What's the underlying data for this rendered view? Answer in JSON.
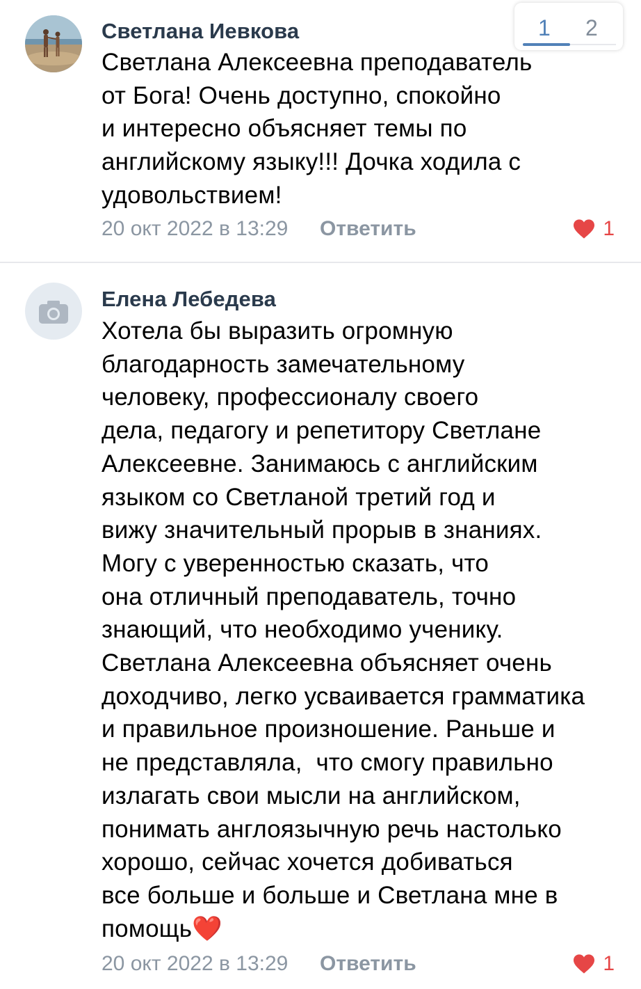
{
  "pagination": {
    "pages": [
      "1",
      "2"
    ],
    "active": "1"
  },
  "comments": [
    {
      "author": "Светлана Иевкова",
      "avatar": "photo-avatar",
      "text": "Светлана Алексеевна преподаватель\nот Бога! Очень доступно, спокойно\nи интересно объясняет темы по\nанглийскому языку!!! Дочка ходила с\nудовольствием!",
      "date": "20 окт 2022 в 13:29",
      "reply_label": "Ответить",
      "likes": "1"
    },
    {
      "author": "Елена Лебедева",
      "avatar": "camera-placeholder-icon",
      "text": "Хотела бы выразить огромную\nблагодарность замечательному\nчеловеку, профессионалу своего\nдела, педагогу и репетитору Светлане\nАлексеевне. Занимаюсь с английским\nязыком со Светланой третий год и\nвижу значительный прорыв в знаниях.\nМогу с уверенностью сказать, что\nона отличный преподаватель, точно\nзнающий, что необходимо ученику.\nСветлана Алексеевна объясняет очень\nдоходчиво, легко усваивается грамматика\nи правильное произношение. Раньше и\nне представляла,  что смогу правильно\nизлагать свои мысли на английском,\nпонимать англоязычную речь настолько\nхорошо, сейчас хочется добиваться\nвсе больше и больше и Светлана мне в\nпомощь",
      "emoji": "❤️",
      "date": "20 окт 2022 в 13:29",
      "reply_label": "Ответить",
      "likes": "1"
    }
  ],
  "colors": {
    "accent": "#5181b8",
    "like": "#e64646",
    "meta": "#8b96a2",
    "author": "#2a3a4c"
  }
}
